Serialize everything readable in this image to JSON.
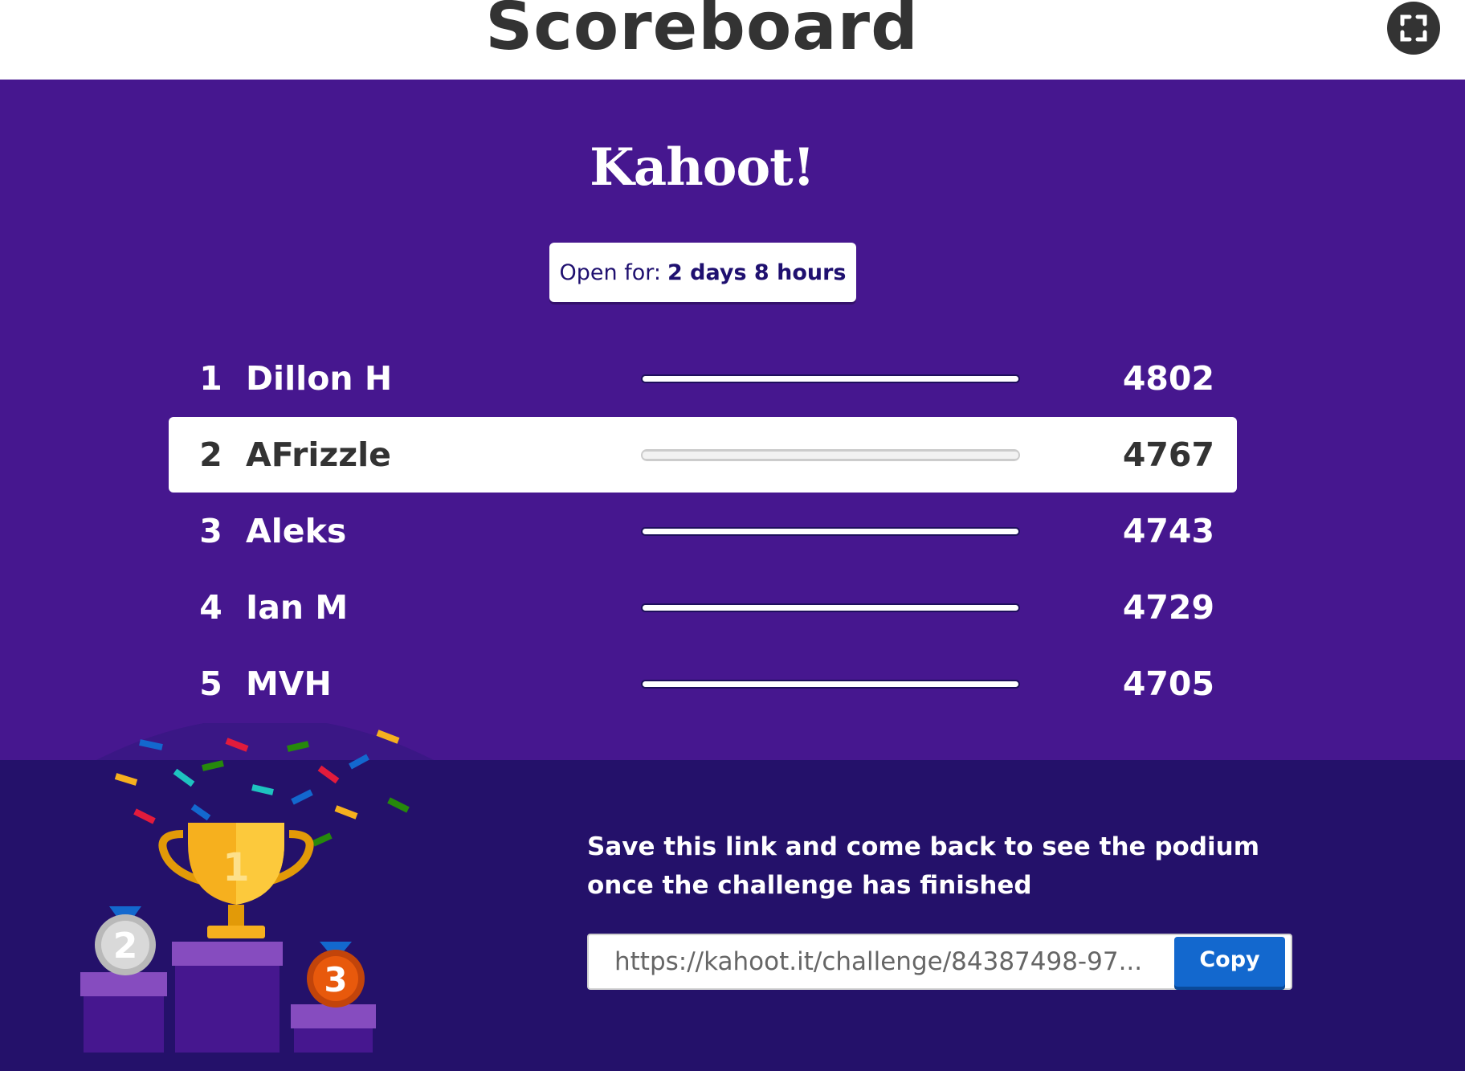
{
  "header": {
    "title": "Scoreboard",
    "fullscreen_icon": "fullscreen-icon"
  },
  "logo": {
    "text": "Kahoot!"
  },
  "open_badge": {
    "label": "Open for:",
    "value": "2 days 8 hours"
  },
  "leaderboard": {
    "rows": [
      {
        "rank": "1",
        "name": "Dillon H",
        "score": "4802",
        "bar_fraction": 1.0,
        "highlighted": false
      },
      {
        "rank": "2",
        "name": "AFrizzle",
        "score": "4767",
        "bar_fraction": 1.0,
        "highlighted": true
      },
      {
        "rank": "3",
        "name": "Aleks",
        "score": "4743",
        "bar_fraction": 1.0,
        "highlighted": false
      },
      {
        "rank": "4",
        "name": "Ian M",
        "score": "4729",
        "bar_fraction": 1.0,
        "highlighted": false
      },
      {
        "rank": "5",
        "name": "MVH",
        "score": "4705",
        "bar_fraction": 1.0,
        "highlighted": false
      }
    ]
  },
  "footer": {
    "message": "Save this link and come back to see the podium once the challenge has finished",
    "link": "https://kahoot.it/challenge/84387498-97...",
    "copy_label": "Copy"
  },
  "podium": {
    "first": "1",
    "second": "2",
    "third": "3"
  },
  "colors": {
    "background": "#46178f",
    "footer": "#24116a",
    "copy_button": "#1368ce",
    "gold": "#f6b01e",
    "silver": "#c8c8c8",
    "bronze": "#e8590c"
  }
}
